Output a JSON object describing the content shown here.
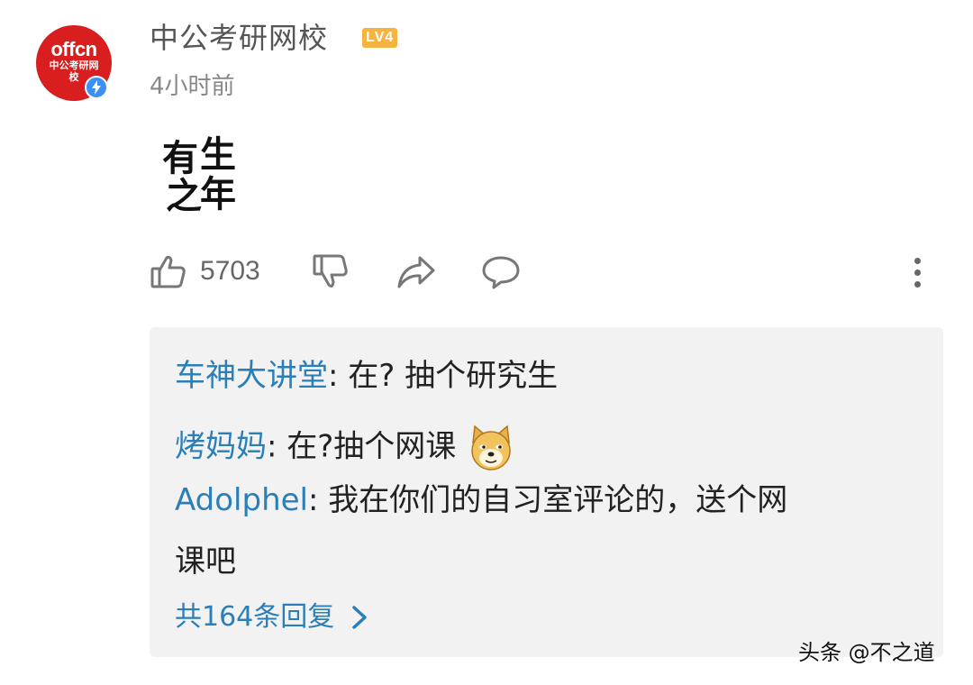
{
  "post": {
    "author": {
      "name": "中公考研网校",
      "level": "LV4",
      "avatar_text": "offcn",
      "avatar_sub": "中公考研网校",
      "avatar_color": "#d81e1e",
      "verified": true
    },
    "time": "4小时前",
    "sticker_chars": [
      "有",
      "生",
      "之",
      "年"
    ]
  },
  "actions": {
    "like_count": "5703",
    "icons": [
      "thumbs-up-icon",
      "thumbs-down-icon",
      "share-icon",
      "comment-icon",
      "more-icon"
    ]
  },
  "replies": {
    "items": [
      {
        "user": "车神大讲堂",
        "text": ": 在? 抽个研究生"
      },
      {
        "user": "烤妈妈",
        "text": ": 在?抽个网课",
        "emoji": "doge-emoji"
      },
      {
        "user": "Adolphel",
        "text": ": 我在你们的自习室评论的，送个网",
        "text_cont": "课吧"
      }
    ],
    "total_label": "共164条回复"
  },
  "watermark": "头条 @不之道",
  "colors": {
    "link": "#2a7fb8",
    "badge": "#f5b342",
    "verified": "#3b8ff6",
    "reply_bg": "#f2f2f2"
  }
}
